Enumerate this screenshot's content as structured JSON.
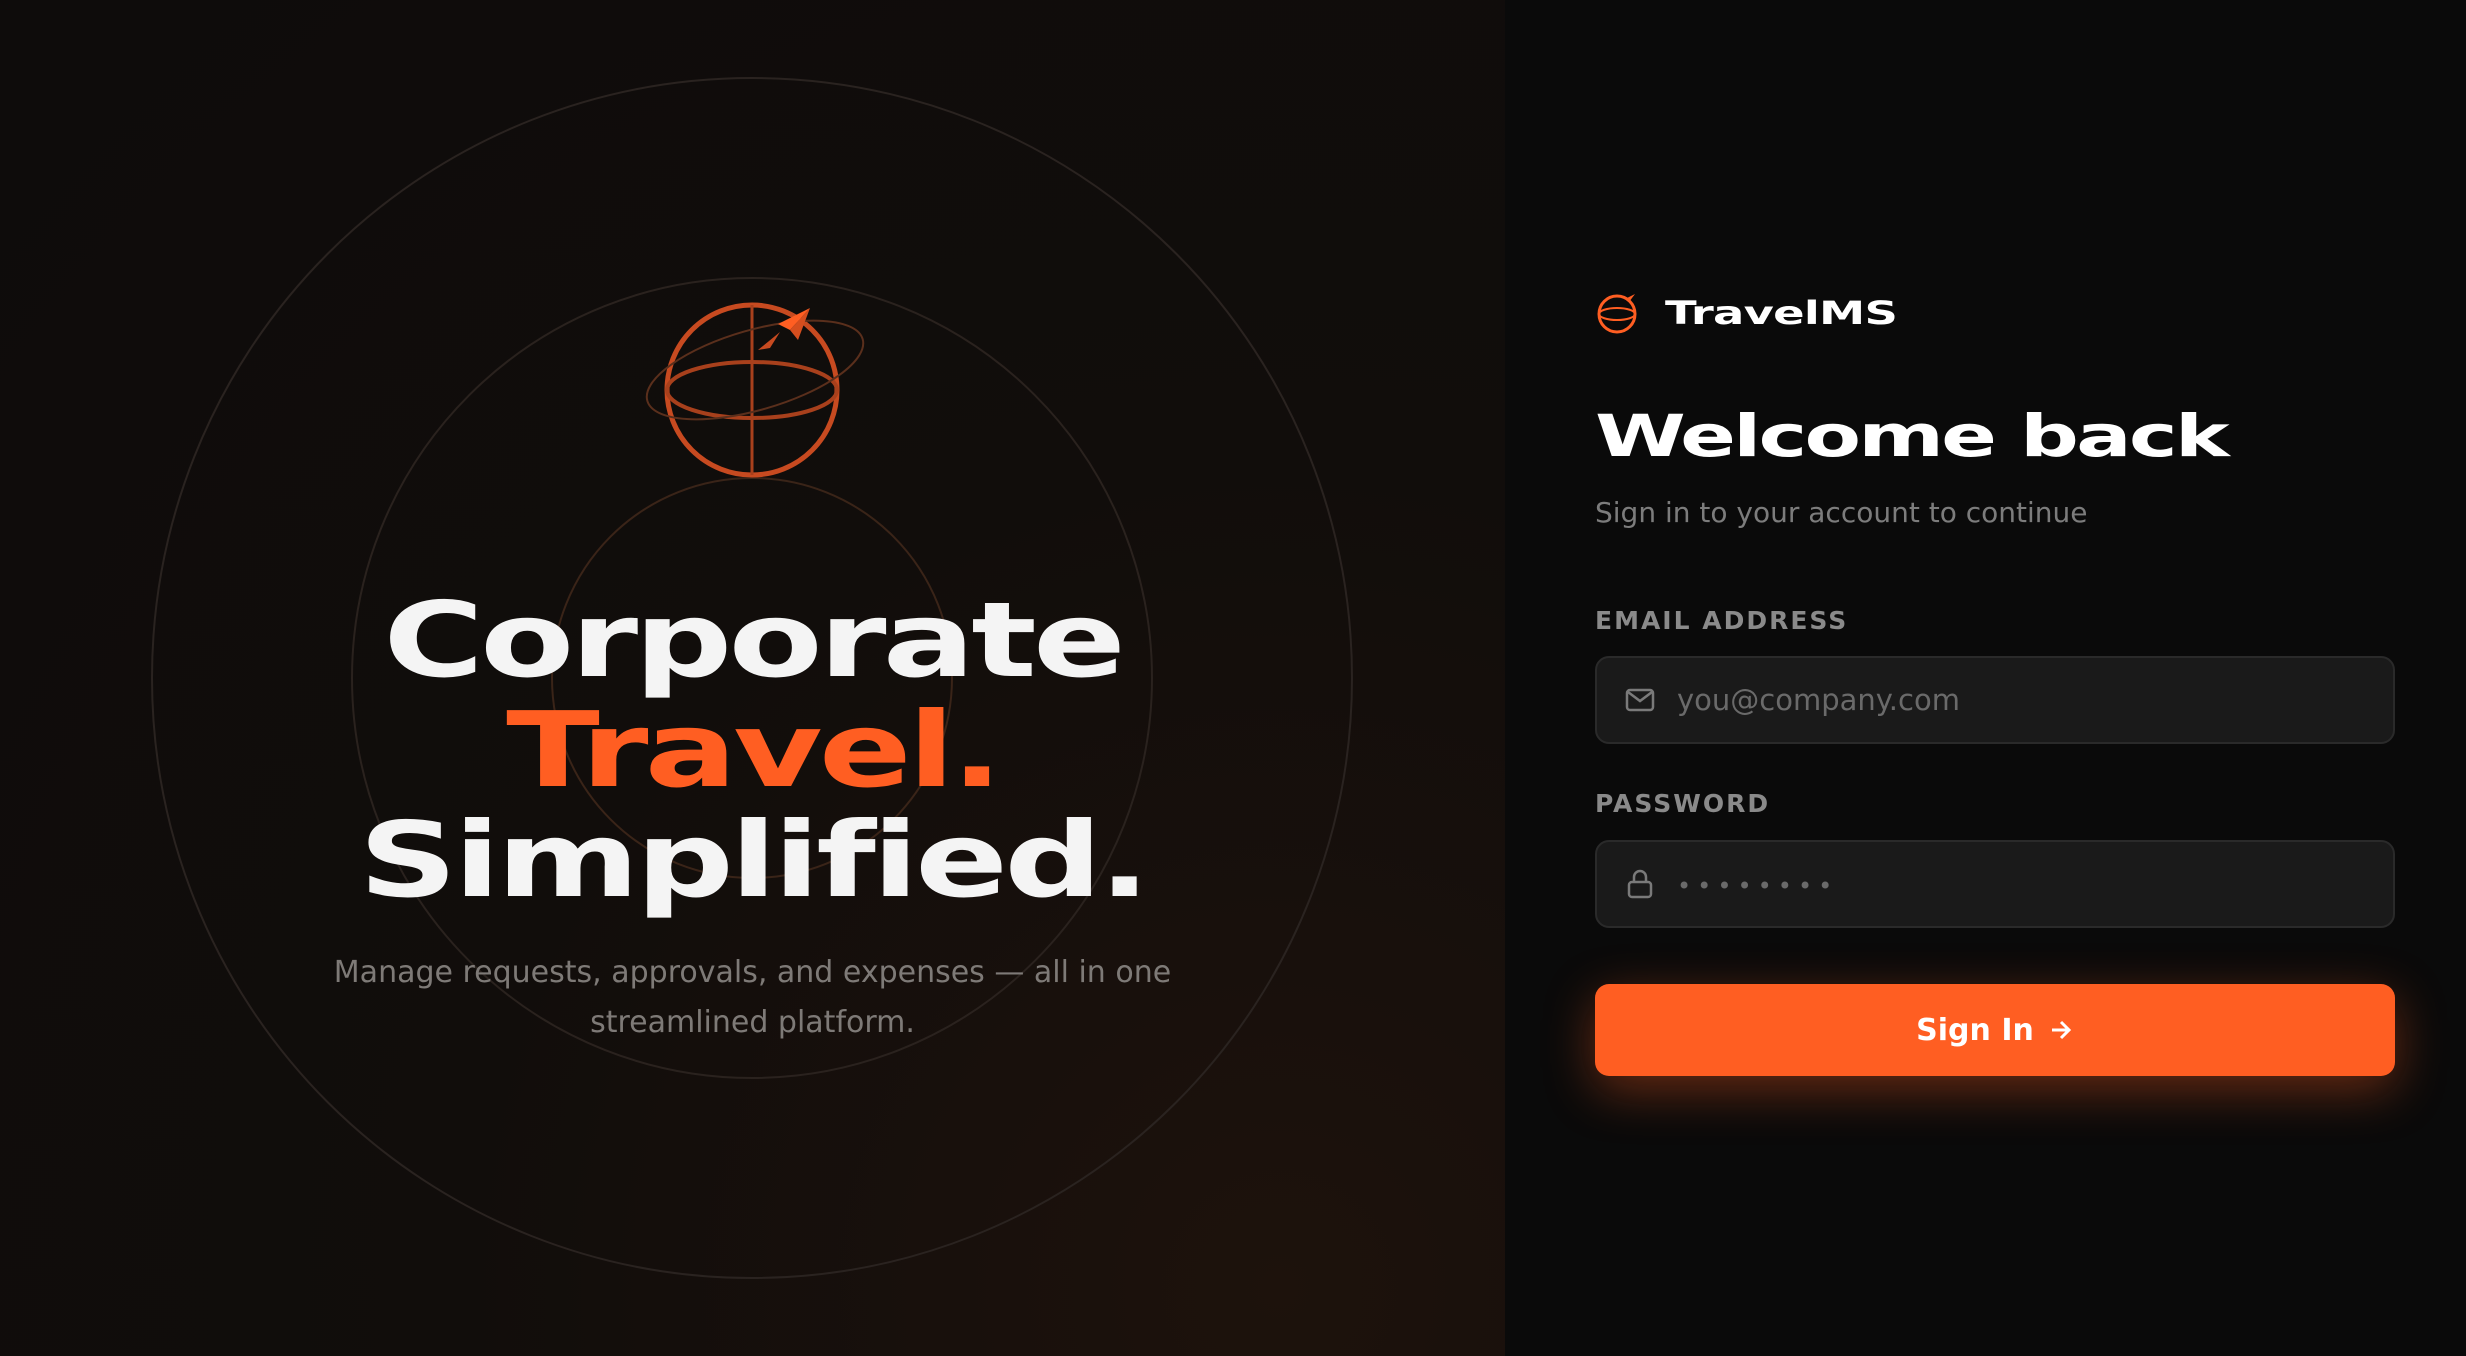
{
  "hero": {
    "title_line1": "Corporate",
    "title_line2": "Travel.",
    "title_line3": "Simplified.",
    "subtitle": "Manage requests, approvals, and expenses — all in one streamlined platform."
  },
  "brand": {
    "name": "TravelMS"
  },
  "form": {
    "heading": "Welcome back",
    "subheading": "Sign in to your account to continue",
    "email": {
      "label": "EMAIL ADDRESS",
      "placeholder": "you@company.com",
      "value": ""
    },
    "password": {
      "label": "PASSWORD",
      "placeholder": "••••••••",
      "value": ""
    },
    "submit_label": "Sign In"
  },
  "icons": {
    "hero": "globe-plane-icon",
    "brand": "globe-logo-icon",
    "email": "mail-icon",
    "password": "lock-icon",
    "submit": "arrow-right-icon"
  },
  "colors": {
    "accent": "#ff5e22",
    "background": "#0a0a0a",
    "input_bg": "#1a1a1a",
    "text_primary": "#ffffff",
    "text_muted": "#7c7c7c"
  }
}
